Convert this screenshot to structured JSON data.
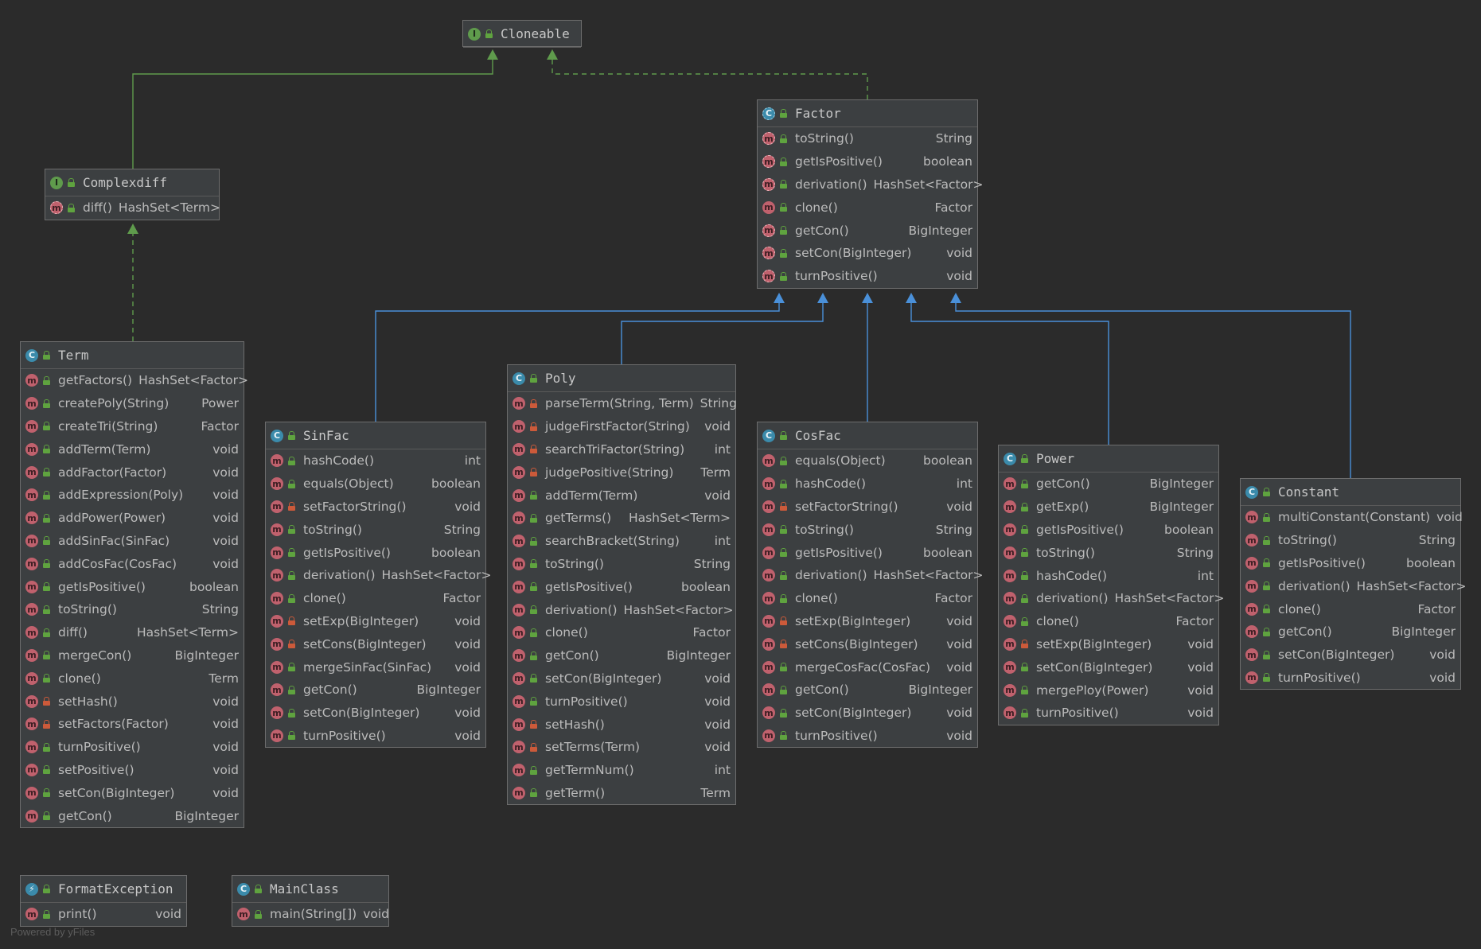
{
  "colors": {
    "background": "#2b2b2b",
    "node_fill": "#3c3f41",
    "node_border": "#6d6d6d",
    "text": "#bbbbbb",
    "interface_edge": "#5f9b4c",
    "class_edge": "#4a90d9",
    "public_icon": "#5fa33f",
    "private_icon": "#cc5a3a",
    "method_badge": "#c0616d",
    "class_badge": "#3b8bab"
  },
  "nodes": [
    {
      "id": "Cloneable",
      "title": "Cloneable",
      "kind": "interface",
      "members": []
    },
    {
      "id": "Complexdiff",
      "title": "Complexdiff",
      "kind": "interface",
      "members": [
        {
          "name": "diff()",
          "type": "HashSet<Term>",
          "vis": "public",
          "kind": "abstract"
        }
      ]
    },
    {
      "id": "Factor",
      "title": "Factor",
      "kind": "abstract",
      "members": [
        {
          "name": "toString()",
          "type": "String",
          "vis": "public",
          "kind": "abstract"
        },
        {
          "name": "getIsPositive()",
          "type": "boolean",
          "vis": "public",
          "kind": "abstract"
        },
        {
          "name": "derivation()",
          "type": "HashSet<Factor>",
          "vis": "public",
          "kind": "abstract"
        },
        {
          "name": "clone()",
          "type": "Factor",
          "vis": "public",
          "kind": "method"
        },
        {
          "name": "getCon()",
          "type": "BigInteger",
          "vis": "public",
          "kind": "abstract"
        },
        {
          "name": "setCon(BigInteger)",
          "type": "void",
          "vis": "public",
          "kind": "abstract"
        },
        {
          "name": "turnPositive()",
          "type": "void",
          "vis": "public",
          "kind": "abstract"
        }
      ]
    },
    {
      "id": "Term",
      "title": "Term",
      "kind": "class",
      "members": [
        {
          "name": "getFactors()",
          "type": "HashSet<Factor>",
          "vis": "public",
          "kind": "method"
        },
        {
          "name": "createPoly(String)",
          "type": "Power",
          "vis": "public",
          "kind": "method"
        },
        {
          "name": "createTri(String)",
          "type": "Factor",
          "vis": "public",
          "kind": "method"
        },
        {
          "name": "addTerm(Term)",
          "type": "void",
          "vis": "public",
          "kind": "method"
        },
        {
          "name": "addFactor(Factor)",
          "type": "void",
          "vis": "public",
          "kind": "method"
        },
        {
          "name": "addExpression(Poly)",
          "type": "void",
          "vis": "public",
          "kind": "method"
        },
        {
          "name": "addPower(Power)",
          "type": "void",
          "vis": "public",
          "kind": "method"
        },
        {
          "name": "addSinFac(SinFac)",
          "type": "void",
          "vis": "public",
          "kind": "method"
        },
        {
          "name": "addCosFac(CosFac)",
          "type": "void",
          "vis": "public",
          "kind": "method"
        },
        {
          "name": "getIsPositive()",
          "type": "boolean",
          "vis": "public",
          "kind": "method"
        },
        {
          "name": "toString()",
          "type": "String",
          "vis": "public",
          "kind": "method"
        },
        {
          "name": "diff()",
          "type": "HashSet<Term>",
          "vis": "public",
          "kind": "method"
        },
        {
          "name": "mergeCon()",
          "type": "BigInteger",
          "vis": "public",
          "kind": "method"
        },
        {
          "name": "clone()",
          "type": "Term",
          "vis": "public",
          "kind": "method"
        },
        {
          "name": "setHash()",
          "type": "void",
          "vis": "private",
          "kind": "method"
        },
        {
          "name": "setFactors(Factor)",
          "type": "void",
          "vis": "private",
          "kind": "method"
        },
        {
          "name": "turnPositive()",
          "type": "void",
          "vis": "public",
          "kind": "method"
        },
        {
          "name": "setPositive()",
          "type": "void",
          "vis": "public",
          "kind": "method"
        },
        {
          "name": "setCon(BigInteger)",
          "type": "void",
          "vis": "public",
          "kind": "method"
        },
        {
          "name": "getCon()",
          "type": "BigInteger",
          "vis": "public",
          "kind": "method"
        }
      ]
    },
    {
      "id": "SinFac",
      "title": "SinFac",
      "kind": "class",
      "members": [
        {
          "name": "hashCode()",
          "type": "int",
          "vis": "public",
          "kind": "method"
        },
        {
          "name": "equals(Object)",
          "type": "boolean",
          "vis": "public",
          "kind": "method"
        },
        {
          "name": "setFactorString()",
          "type": "void",
          "vis": "private",
          "kind": "method"
        },
        {
          "name": "toString()",
          "type": "String",
          "vis": "public",
          "kind": "method"
        },
        {
          "name": "getIsPositive()",
          "type": "boolean",
          "vis": "public",
          "kind": "method"
        },
        {
          "name": "derivation()",
          "type": "HashSet<Factor>",
          "vis": "public",
          "kind": "method"
        },
        {
          "name": "clone()",
          "type": "Factor",
          "vis": "public",
          "kind": "method"
        },
        {
          "name": "setExp(BigInteger)",
          "type": "void",
          "vis": "private",
          "kind": "method"
        },
        {
          "name": "setCons(BigInteger)",
          "type": "void",
          "vis": "private",
          "kind": "method"
        },
        {
          "name": "mergeSinFac(SinFac)",
          "type": "void",
          "vis": "public",
          "kind": "method"
        },
        {
          "name": "getCon()",
          "type": "BigInteger",
          "vis": "public",
          "kind": "method"
        },
        {
          "name": "setCon(BigInteger)",
          "type": "void",
          "vis": "public",
          "kind": "method"
        },
        {
          "name": "turnPositive()",
          "type": "void",
          "vis": "public",
          "kind": "method"
        }
      ]
    },
    {
      "id": "Poly",
      "title": "Poly",
      "kind": "class",
      "members": [
        {
          "name": "parseTerm(String, Term)",
          "type": "String",
          "vis": "private",
          "kind": "method"
        },
        {
          "name": "judgeFirstFactor(String)",
          "type": "void",
          "vis": "private",
          "kind": "method"
        },
        {
          "name": "searchTriFactor(String)",
          "type": "int",
          "vis": "private",
          "kind": "method"
        },
        {
          "name": "judgePositive(String)",
          "type": "Term",
          "vis": "private",
          "kind": "method"
        },
        {
          "name": "addTerm(Term)",
          "type": "void",
          "vis": "public",
          "kind": "method"
        },
        {
          "name": "getTerms()",
          "type": "HashSet<Term>",
          "vis": "public",
          "kind": "method"
        },
        {
          "name": "searchBracket(String)",
          "type": "int",
          "vis": "public",
          "kind": "method"
        },
        {
          "name": "toString()",
          "type": "String",
          "vis": "public",
          "kind": "method"
        },
        {
          "name": "getIsPositive()",
          "type": "boolean",
          "vis": "public",
          "kind": "method"
        },
        {
          "name": "derivation()",
          "type": "HashSet<Factor>",
          "vis": "public",
          "kind": "method"
        },
        {
          "name": "clone()",
          "type": "Factor",
          "vis": "public",
          "kind": "method"
        },
        {
          "name": "getCon()",
          "type": "BigInteger",
          "vis": "public",
          "kind": "method"
        },
        {
          "name": "setCon(BigInteger)",
          "type": "void",
          "vis": "public",
          "kind": "method"
        },
        {
          "name": "turnPositive()",
          "type": "void",
          "vis": "public",
          "kind": "method"
        },
        {
          "name": "setHash()",
          "type": "void",
          "vis": "private",
          "kind": "method"
        },
        {
          "name": "setTerms(Term)",
          "type": "void",
          "vis": "private",
          "kind": "method"
        },
        {
          "name": "getTermNum()",
          "type": "int",
          "vis": "public",
          "kind": "method"
        },
        {
          "name": "getTerm()",
          "type": "Term",
          "vis": "public",
          "kind": "method"
        }
      ]
    },
    {
      "id": "CosFac",
      "title": "CosFac",
      "kind": "class",
      "members": [
        {
          "name": "equals(Object)",
          "type": "boolean",
          "vis": "public",
          "kind": "method"
        },
        {
          "name": "hashCode()",
          "type": "int",
          "vis": "public",
          "kind": "method"
        },
        {
          "name": "setFactorString()",
          "type": "void",
          "vis": "private",
          "kind": "method"
        },
        {
          "name": "toString()",
          "type": "String",
          "vis": "public",
          "kind": "method"
        },
        {
          "name": "getIsPositive()",
          "type": "boolean",
          "vis": "public",
          "kind": "method"
        },
        {
          "name": "derivation()",
          "type": "HashSet<Factor>",
          "vis": "public",
          "kind": "method"
        },
        {
          "name": "clone()",
          "type": "Factor",
          "vis": "public",
          "kind": "method"
        },
        {
          "name": "setExp(BigInteger)",
          "type": "void",
          "vis": "private",
          "kind": "method"
        },
        {
          "name": "setCons(BigInteger)",
          "type": "void",
          "vis": "private",
          "kind": "method"
        },
        {
          "name": "mergeCosFac(CosFac)",
          "type": "void",
          "vis": "public",
          "kind": "method"
        },
        {
          "name": "getCon()",
          "type": "BigInteger",
          "vis": "public",
          "kind": "method"
        },
        {
          "name": "setCon(BigInteger)",
          "type": "void",
          "vis": "public",
          "kind": "method"
        },
        {
          "name": "turnPositive()",
          "type": "void",
          "vis": "public",
          "kind": "method"
        }
      ]
    },
    {
      "id": "Power",
      "title": "Power",
      "kind": "class",
      "members": [
        {
          "name": "getCon()",
          "type": "BigInteger",
          "vis": "public",
          "kind": "method"
        },
        {
          "name": "getExp()",
          "type": "BigInteger",
          "vis": "public",
          "kind": "method"
        },
        {
          "name": "getIsPositive()",
          "type": "boolean",
          "vis": "public",
          "kind": "method"
        },
        {
          "name": "toString()",
          "type": "String",
          "vis": "public",
          "kind": "method"
        },
        {
          "name": "hashCode()",
          "type": "int",
          "vis": "public",
          "kind": "method"
        },
        {
          "name": "derivation()",
          "type": "HashSet<Factor>",
          "vis": "public",
          "kind": "method"
        },
        {
          "name": "clone()",
          "type": "Factor",
          "vis": "public",
          "kind": "method"
        },
        {
          "name": "setExp(BigInteger)",
          "type": "void",
          "vis": "private",
          "kind": "method"
        },
        {
          "name": "setCon(BigInteger)",
          "type": "void",
          "vis": "public",
          "kind": "method"
        },
        {
          "name": "mergePloy(Power)",
          "type": "void",
          "vis": "public",
          "kind": "method"
        },
        {
          "name": "turnPositive()",
          "type": "void",
          "vis": "public",
          "kind": "method"
        }
      ]
    },
    {
      "id": "Constant",
      "title": "Constant",
      "kind": "class",
      "members": [
        {
          "name": "multiConstant(Constant)",
          "type": "void",
          "vis": "public",
          "kind": "method"
        },
        {
          "name": "toString()",
          "type": "String",
          "vis": "public",
          "kind": "method"
        },
        {
          "name": "getIsPositive()",
          "type": "boolean",
          "vis": "public",
          "kind": "method"
        },
        {
          "name": "derivation()",
          "type": "HashSet<Factor>",
          "vis": "public",
          "kind": "method"
        },
        {
          "name": "clone()",
          "type": "Factor",
          "vis": "public",
          "kind": "method"
        },
        {
          "name": "getCon()",
          "type": "BigInteger",
          "vis": "public",
          "kind": "method"
        },
        {
          "name": "setCon(BigInteger)",
          "type": "void",
          "vis": "public",
          "kind": "method"
        },
        {
          "name": "turnPositive()",
          "type": "void",
          "vis": "public",
          "kind": "method"
        }
      ]
    },
    {
      "id": "FormatException",
      "title": "FormatException",
      "kind": "exception",
      "members": [
        {
          "name": "print()",
          "type": "void",
          "vis": "public",
          "kind": "method"
        }
      ]
    },
    {
      "id": "MainClass",
      "title": "MainClass",
      "kind": "class",
      "members": [
        {
          "name": "main(String[])",
          "type": "void",
          "vis": "public",
          "kind": "static"
        }
      ]
    }
  ],
  "edges": [
    {
      "from": "Complexdiff",
      "to": "Cloneable",
      "style": "solid",
      "relation": "extends"
    },
    {
      "from": "Factor",
      "to": "Cloneable",
      "style": "dashed",
      "relation": "implements"
    },
    {
      "from": "Term",
      "to": "Complexdiff",
      "style": "dashed",
      "relation": "implements"
    },
    {
      "from": "SinFac",
      "to": "Factor",
      "style": "solid",
      "relation": "extends"
    },
    {
      "from": "Poly",
      "to": "Factor",
      "style": "solid",
      "relation": "extends"
    },
    {
      "from": "CosFac",
      "to": "Factor",
      "style": "solid",
      "relation": "extends"
    },
    {
      "from": "Power",
      "to": "Factor",
      "style": "solid",
      "relation": "extends"
    },
    {
      "from": "Constant",
      "to": "Factor",
      "style": "solid",
      "relation": "extends"
    }
  ],
  "footer": "Powered by yFiles"
}
